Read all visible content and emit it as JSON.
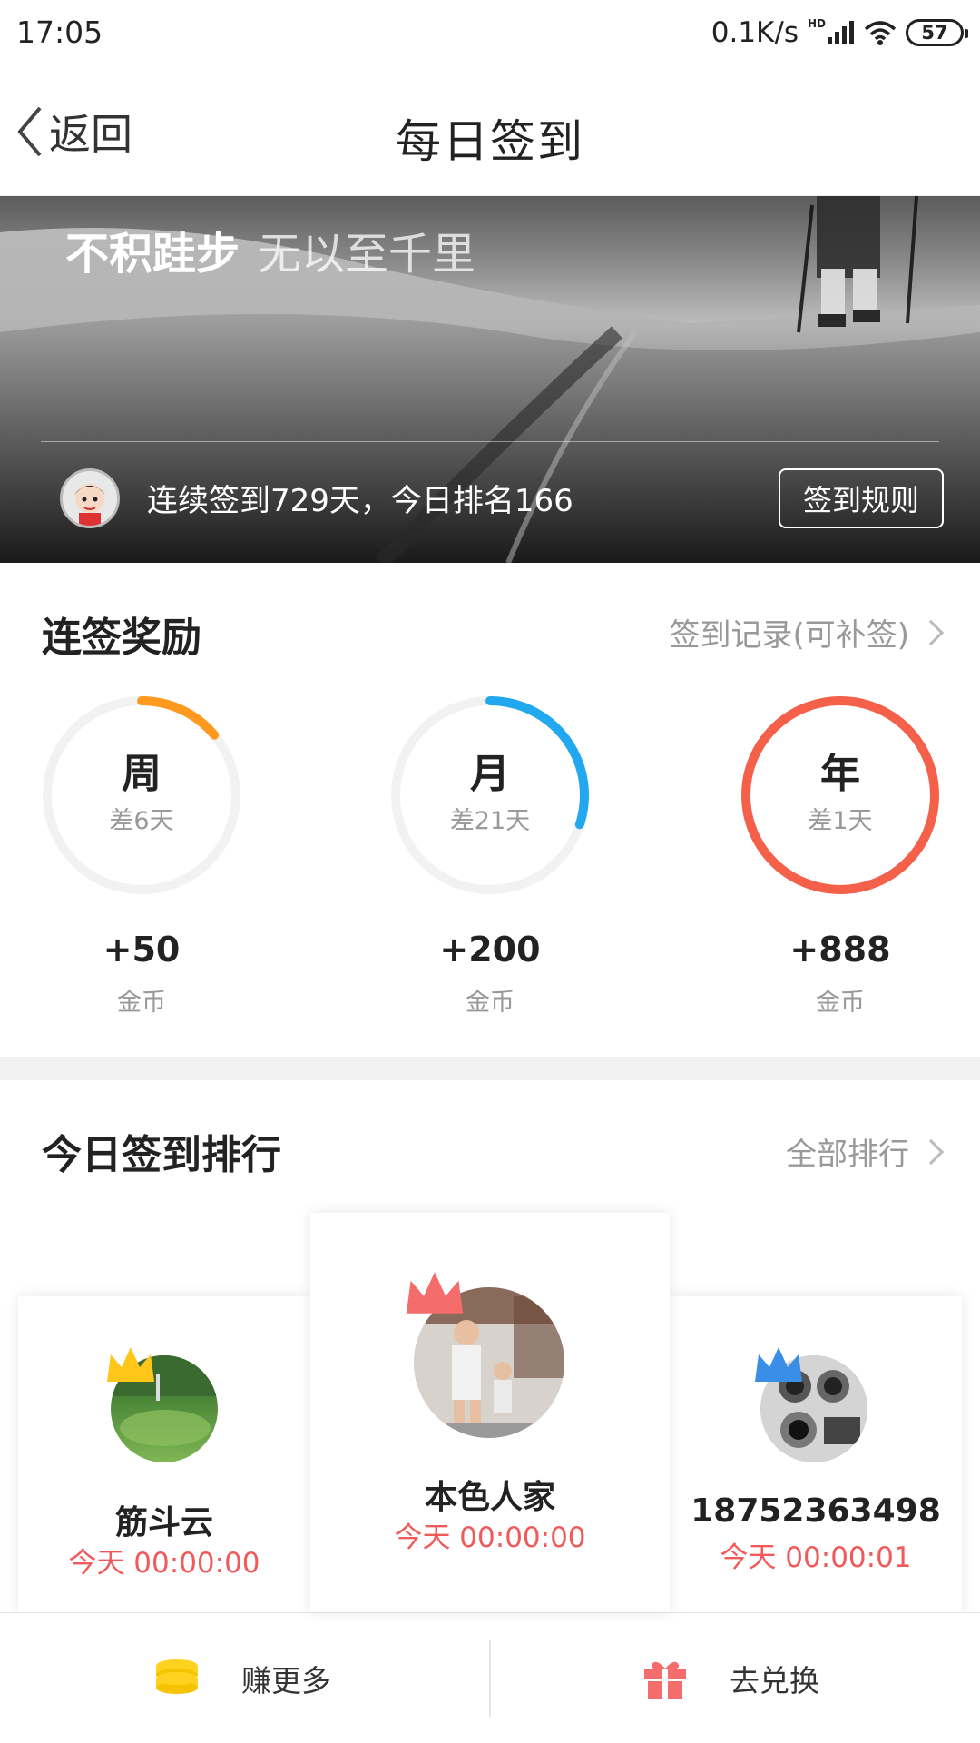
{
  "status_bar": {
    "time": "17:05",
    "network_speed": "0.1K/s",
    "network_label": "HD",
    "battery": "57"
  },
  "nav": {
    "back_label": "返回",
    "title": "每日签到"
  },
  "banner": {
    "slogan_main": "不积跬步",
    "slogan_sub": "无以至千里",
    "streak_text": "连续签到729天，今日排名166",
    "rules_label": "签到规则"
  },
  "rewards": {
    "title": "连签奖励",
    "link": "签到记录(可补签)",
    "items": [
      {
        "label": "周",
        "remaining": "差6天",
        "amount": "+50",
        "unit": "金币",
        "progress": 0.14,
        "color": "#ff9a1e"
      },
      {
        "label": "月",
        "remaining": "差21天",
        "amount": "+200",
        "unit": "金币",
        "progress": 0.3,
        "color": "#21a8ee"
      },
      {
        "label": "年",
        "remaining": "差1天",
        "amount": "+888",
        "unit": "金币",
        "progress": 1.0,
        "color": "#f4604a"
      }
    ]
  },
  "ranking": {
    "title": "今日签到排行",
    "link": "全部排行",
    "entries": [
      {
        "name": "筋斗云",
        "time": "今天 00:00:00",
        "crown_color": "#ffc61a"
      },
      {
        "name": "本色人家",
        "time": "今天 00:00:00",
        "crown_color": "#f46c6c"
      },
      {
        "name": "18752363498",
        "time": "今天 00:00:01",
        "crown_color": "#3a8ee6"
      }
    ]
  },
  "bottom_bar": {
    "earn_label": "赚更多",
    "exchange_label": "去兑换"
  },
  "colors": {
    "accent_red": "#f05a5a",
    "coin_yellow": "#ffd21f",
    "gift_red": "#f46c6c"
  }
}
